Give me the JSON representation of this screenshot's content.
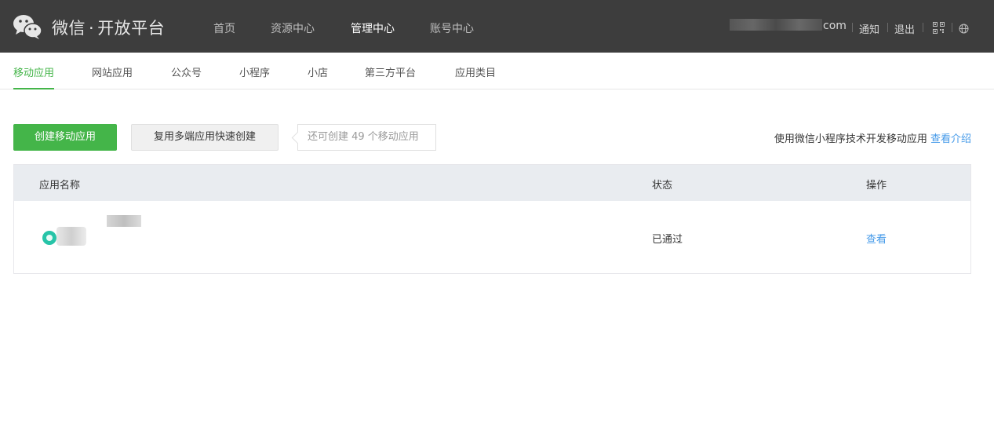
{
  "header": {
    "brand_name": "微信",
    "brand_dot": "·",
    "brand_sub": "开放平台",
    "nav": [
      {
        "label": "首页",
        "active": false
      },
      {
        "label": "资源中心",
        "active": false
      },
      {
        "label": "管理中心",
        "active": true
      },
      {
        "label": "账号中心",
        "active": false
      }
    ],
    "user_suffix": "com",
    "notify_label": "通知",
    "logout_label": "退出",
    "icons": [
      "qrcode-icon",
      "globe-icon"
    ]
  },
  "subnav": {
    "items": [
      {
        "label": "移动应用",
        "active": true
      },
      {
        "label": "网站应用",
        "active": false
      },
      {
        "label": "公众号",
        "active": false
      },
      {
        "label": "小程序",
        "active": false
      },
      {
        "label": "小店",
        "active": false
      },
      {
        "label": "第三方平台",
        "active": false
      },
      {
        "label": "应用类目",
        "active": false
      }
    ]
  },
  "toolbar": {
    "create_label": "创建移动应用",
    "reuse_label": "复用多端应用快速创建",
    "remaining_tip": "还可创建 49 个移动应用",
    "hint_text": "使用微信小程序技术开发移动应用",
    "hint_link": "查看介绍"
  },
  "table": {
    "columns": [
      "应用名称",
      "状态",
      "操作"
    ],
    "rows": [
      {
        "status": "已通过",
        "action": "查看"
      }
    ]
  },
  "colors": {
    "accent_green": "#44b549",
    "link_blue": "#459ae9",
    "topbar_bg": "#3d3d3d"
  }
}
